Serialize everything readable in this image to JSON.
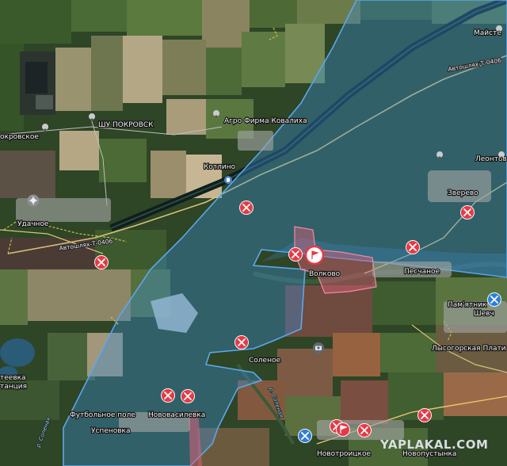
{
  "map": {
    "labels": {
      "shu_pokrovsk": "ШУ ПОКРОВСК",
      "agro_firma": "Агро Фирма Ковалиха",
      "pokrovskoe": "окровское",
      "kotlino": "Котлино",
      "udachnoe": "Удачное",
      "road_west": "Автошлях-Т-0406",
      "road_east": "Автошлях-Т-0406",
      "maister": "Майсте",
      "leontov": "Леонтов",
      "zverevo": "Зверево",
      "volkovo": "Волково",
      "peschanoe": "Песчаное",
      "pamyatnik": "Пам'ятник",
      "shevch": "Шевч",
      "lysogorskaya": "Лысогорская Плати",
      "solenoe": "Соленое",
      "river_solenaya_1": "р. Соленая",
      "river_solenaya_2": "р. Соленая",
      "teevka": "теевка",
      "stantsiya": "танция",
      "football": "Футбольное поле",
      "novovasilevka": "Нововасилевка",
      "uspenovka": "Успеновка",
      "novotroitskoe": "Новотроицкое",
      "novopustynka": "Новопустынка"
    },
    "watermark": "YAPLAKAL.COM",
    "colors": {
      "controlled_zone": "#3b8fd6",
      "contested_zone": "#e0607a",
      "marker_red": "#e53a45",
      "marker_blue": "#2f7fd8"
    },
    "markers": [
      {
        "type": "combat",
        "color": "red"
      },
      {
        "type": "combat",
        "color": "red"
      },
      {
        "type": "combat",
        "color": "red"
      },
      {
        "type": "combat",
        "color": "red"
      },
      {
        "type": "combat",
        "color": "red"
      },
      {
        "type": "combat",
        "color": "red"
      },
      {
        "type": "combat",
        "color": "red"
      },
      {
        "type": "combat",
        "color": "red"
      },
      {
        "type": "combat",
        "color": "red"
      },
      {
        "type": "combat",
        "color": "red"
      },
      {
        "type": "combat",
        "color": "red"
      },
      {
        "type": "combat",
        "color": "blue"
      },
      {
        "type": "combat",
        "color": "blue"
      },
      {
        "type": "flag",
        "color": "red"
      },
      {
        "type": "flag",
        "color": "red"
      }
    ]
  }
}
